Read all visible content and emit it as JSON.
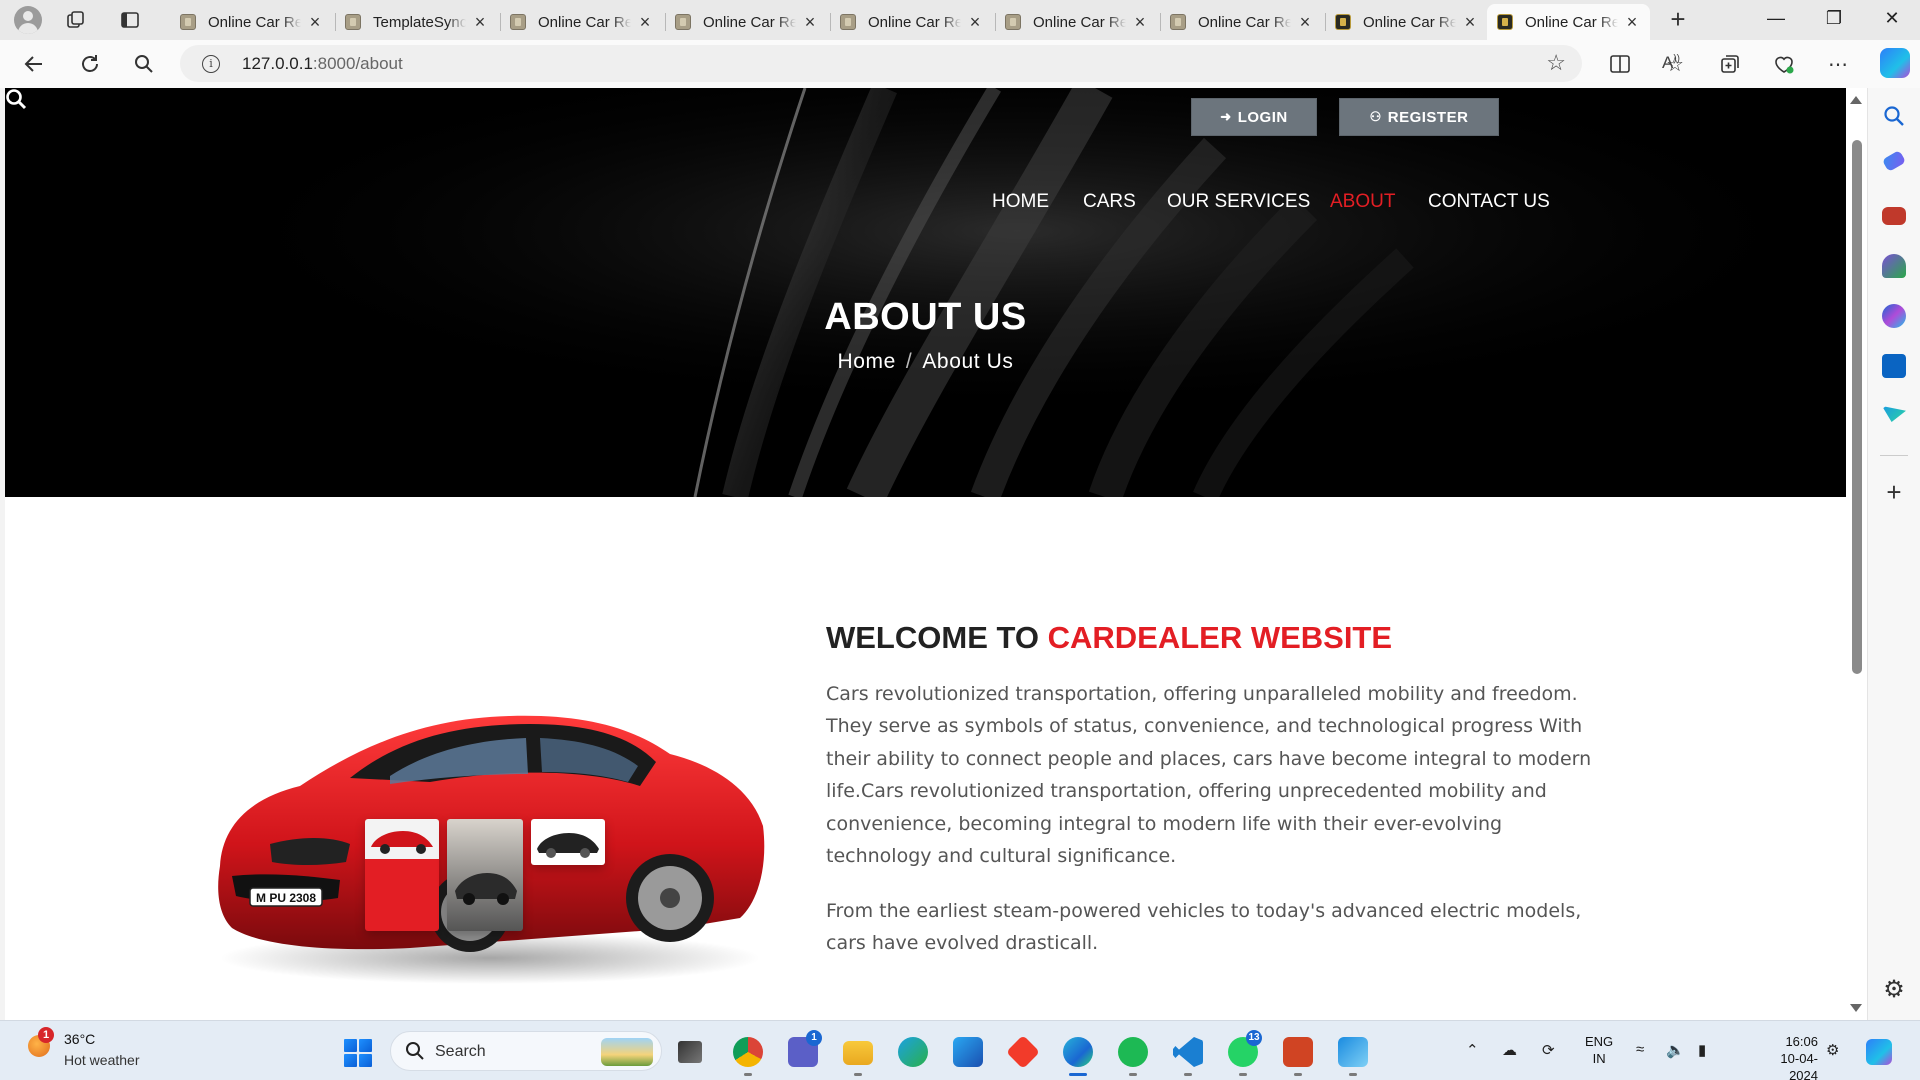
{
  "browser": {
    "tabs": [
      {
        "title": "Online Car Rental",
        "favicon": "site-favicon"
      },
      {
        "title": "TemplateSync",
        "favicon": "site-favicon"
      },
      {
        "title": "Online Car Rental",
        "favicon": "site-favicon"
      },
      {
        "title": "Online Car Rental",
        "favicon": "site-favicon"
      },
      {
        "title": "Online Car Rental",
        "favicon": "site-favicon"
      },
      {
        "title": "Online Car Rental",
        "favicon": "site-favicon"
      },
      {
        "title": "Online Car Rental",
        "favicon": "site-favicon"
      },
      {
        "title": "Online Car Rental",
        "favicon": "site-favicon-dark"
      },
      {
        "title": "Online Car Rental",
        "favicon": "site-favicon-dark",
        "active": true
      }
    ],
    "url_host": "127.0.0.1",
    "url_path": ":8000/about"
  },
  "site": {
    "auth": {
      "login_label": "LOGIN",
      "register_label": "REGISTER"
    },
    "nav": [
      {
        "label": "HOME"
      },
      {
        "label": "CARS"
      },
      {
        "label": "OUR SERVICES"
      },
      {
        "label": "ABOUT",
        "active": true
      },
      {
        "label": "CONTACT US"
      }
    ],
    "hero": {
      "title": "ABOUT US",
      "crumb_home": "Home",
      "crumb_current": "About Us"
    },
    "welcome": {
      "prefix": "WELCOME TO ",
      "highlight": "CARDEALER WEBSITE"
    },
    "paragraphs": [
      "Cars revolutionized transportation, offering unparalleled mobility and freedom. They serve as symbols of status, convenience, and technological progress With their ability to connect people and places, cars have become integral to modern life.Cars revolutionized transportation, offering unprecedented mobility and convenience, becoming integral to modern life with their ever-evolving technology and cultural significance.",
      "From the earliest steam-powered vehicles to today's advanced electric models, cars have evolved drasticall."
    ],
    "car_plate": "M PU 2308",
    "accent_color": "#e31e24"
  },
  "taskbar": {
    "weather_temp": "36°C",
    "weather_desc": "Hot weather",
    "weather_badge": "1",
    "search_label": "Search",
    "teams_badge": "1",
    "whatsapp_badge": "13",
    "lang_line1": "ENG",
    "lang_line2": "IN",
    "time": "16:06",
    "date": "10-04-2024"
  }
}
